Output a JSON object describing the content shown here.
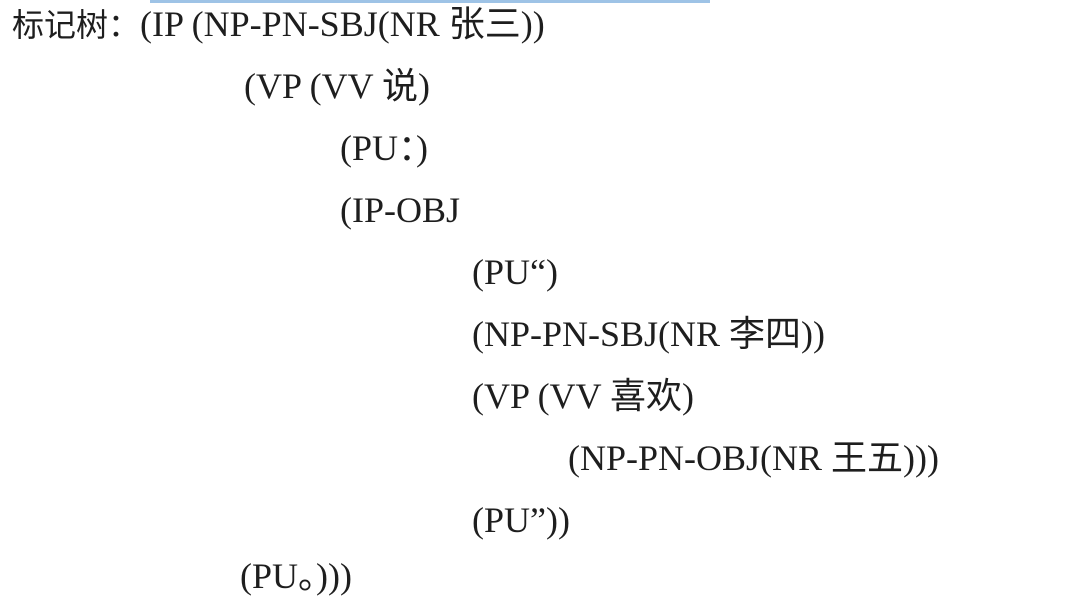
{
  "document": {
    "label": "标记树：",
    "lines": [
      "(IP (NP-PN-SBJ(NR 张三))",
      "(VP (VV 说)",
      "(PU：)",
      "(IP-OBJ",
      "(PU“)",
      "(NP-PN-SBJ(NR 李四))",
      "(VP (VV 喜欢)",
      "(NP-PN-OBJ(NR 王五)))",
      "(PU”))",
      "(PU。)))"
    ]
  }
}
